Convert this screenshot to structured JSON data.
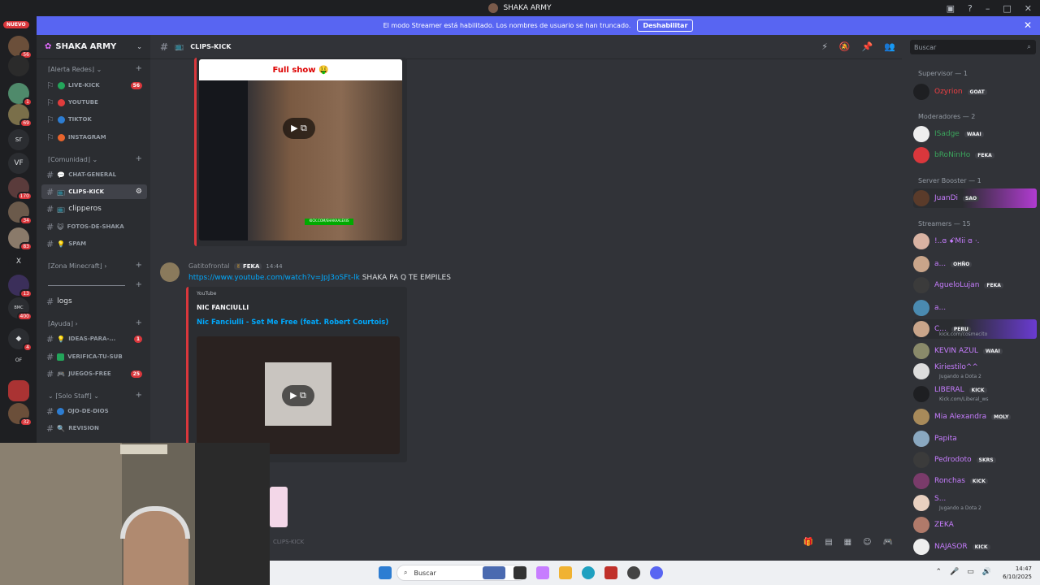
{
  "window": {
    "title": "SHAKA ARMY"
  },
  "banner": {
    "text": "El modo Streamer está habilitado. Los nombres de usuario se han truncado.",
    "button": "Deshabilitar"
  },
  "servers": {
    "new_badge": "NUEVO",
    "items": [
      {
        "label": "",
        "badge": "56"
      },
      {
        "label": "",
        "badge": ""
      },
      {
        "label": "",
        "badge": "1"
      },
      {
        "label": "",
        "badge": "69"
      },
      {
        "label": "sr",
        "badge": ""
      },
      {
        "label": "VF",
        "badge": ""
      },
      {
        "label": "",
        "badge": "170"
      },
      {
        "label": "",
        "badge": "34"
      },
      {
        "label": "",
        "badge": "83"
      },
      {
        "label": "X",
        "badge": ""
      },
      {
        "label": "",
        "badge": "13"
      },
      {
        "label": "",
        "badge": "400"
      },
      {
        "label": "",
        "badge": "4"
      },
      {
        "label": "OF",
        "badge": ""
      },
      {
        "label": "",
        "badge": ""
      },
      {
        "label": "",
        "badge": "32"
      }
    ]
  },
  "sidebar": {
    "server_name": "SHAKA ARMY",
    "categories": {
      "alerta": "⌈Alerta Redes⌋",
      "comunidad": "⌈Comunidad⌋",
      "minecraft": "⌈Zona Minecraft⌋",
      "ayuda": "⌈Ayuda⌋",
      "staff": "⌈Solo Staff⌋"
    },
    "channels": {
      "live_kick": "LIVE-KICK",
      "live_kick_count": "56",
      "youtube": "YOUTUBE",
      "tiktok": "TIKTOK",
      "instagram": "INSTAGRAM",
      "chat_general": "CHAT-GENERAL",
      "clips_kick": "CLIPS-KICK",
      "clipers": "clipperos",
      "fotos": "FOTOS-DE-SHAKA",
      "spam": "SPAM",
      "logs": "logs",
      "ideas": "IDEAS-PARA-...",
      "ideas_count": "1",
      "verifica": "VERIFICA-TU-SUB",
      "juegos": "JUEGOS-FREE",
      "juegos_count": "25",
      "ojo": "OJO-DE-DIOS",
      "revision": "REVISION"
    }
  },
  "topbar": {
    "channel": "CLIPS-KICK",
    "search_placeholder": "Buscar"
  },
  "chat": {
    "embed1_title": "Full show 🤑",
    "embed1_caption": "KICK.COM/SHAKAALEXIS",
    "message": {
      "author": "Gatitofrontal",
      "tag": "FEKA",
      "time": "14:44",
      "link": "https://www.youtube.com/watch?v=JpJ3oSFt-lk",
      "text": " SHAKA PA Q TE EMPILES"
    },
    "embed2": {
      "provider": "YouTube",
      "author": "NIC FANCIULLI",
      "title": "Nic Fanciulli - Set Me Free (feat. Robert Courtois)"
    },
    "composer_placeholder": "CLIPS-KICK"
  },
  "members": {
    "groups": {
      "supervisor": "Supervisor — 1",
      "moderadores": "Moderadores — 2",
      "booster": "Server Booster — 1",
      "streamers": "Streamers — 15"
    },
    "list": [
      {
        "name": "Ozyrion",
        "tag": "GOAT",
        "sub": "",
        "color": "#f23f43"
      },
      {
        "name": "ISadge",
        "tag": "WAAI",
        "sub": "",
        "color": "#3ba55c"
      },
      {
        "name": "bRoNinHo",
        "tag": "FEKA",
        "sub": "",
        "color": "#3ba55c"
      },
      {
        "name": "JuanDi",
        "tag": "SAO",
        "sub": "",
        "color": "#c77dff"
      },
      {
        "name": "!..ɞ ꗃMii ɞ ·.",
        "tag": "",
        "sub": "",
        "color": "#c77dff"
      },
      {
        "name": "a...",
        "tag": "OHÑO",
        "sub": "",
        "color": "#c77dff"
      },
      {
        "name": "AgueloLujan",
        "tag": "FEKA",
        "sub": "",
        "color": "#c77dff"
      },
      {
        "name": "a...",
        "tag": "",
        "sub": "",
        "color": "#c77dff"
      },
      {
        "name": "C...",
        "tag": "PERU",
        "sub": "kick.com/cosmecito",
        "color": "#c77dff"
      },
      {
        "name": "KEVIN AZUL",
        "tag": "WAAI",
        "sub": "",
        "color": "#c77dff"
      },
      {
        "name": "Kiriestilo^^",
        "tag": "",
        "sub": "Jugando a Dota 2",
        "color": "#c77dff"
      },
      {
        "name": "LIBERAL",
        "tag": "KICK",
        "sub": "Kick.com/Liberal_ws",
        "color": "#c77dff"
      },
      {
        "name": "Mia Alexandra",
        "tag": "MOLY",
        "sub": "",
        "color": "#c77dff"
      },
      {
        "name": "Papita",
        "tag": "",
        "sub": "",
        "color": "#c77dff"
      },
      {
        "name": "Pedrodoto",
        "tag": "SKRS",
        "sub": "",
        "color": "#c77dff"
      },
      {
        "name": "Ronchas",
        "tag": "KICK",
        "sub": "",
        "color": "#c77dff"
      },
      {
        "name": "S...",
        "tag": "",
        "sub": "Jugando a Dota 2",
        "color": "#c77dff"
      },
      {
        "name": "ZEKA",
        "tag": "",
        "sub": "",
        "color": "#c77dff"
      },
      {
        "name": "NAJASOR",
        "tag": "KICK",
        "sub": "",
        "color": "#c77dff"
      }
    ]
  },
  "taskbar": {
    "search": "Buscar",
    "time": "14:47",
    "date": "6/10/2025"
  }
}
